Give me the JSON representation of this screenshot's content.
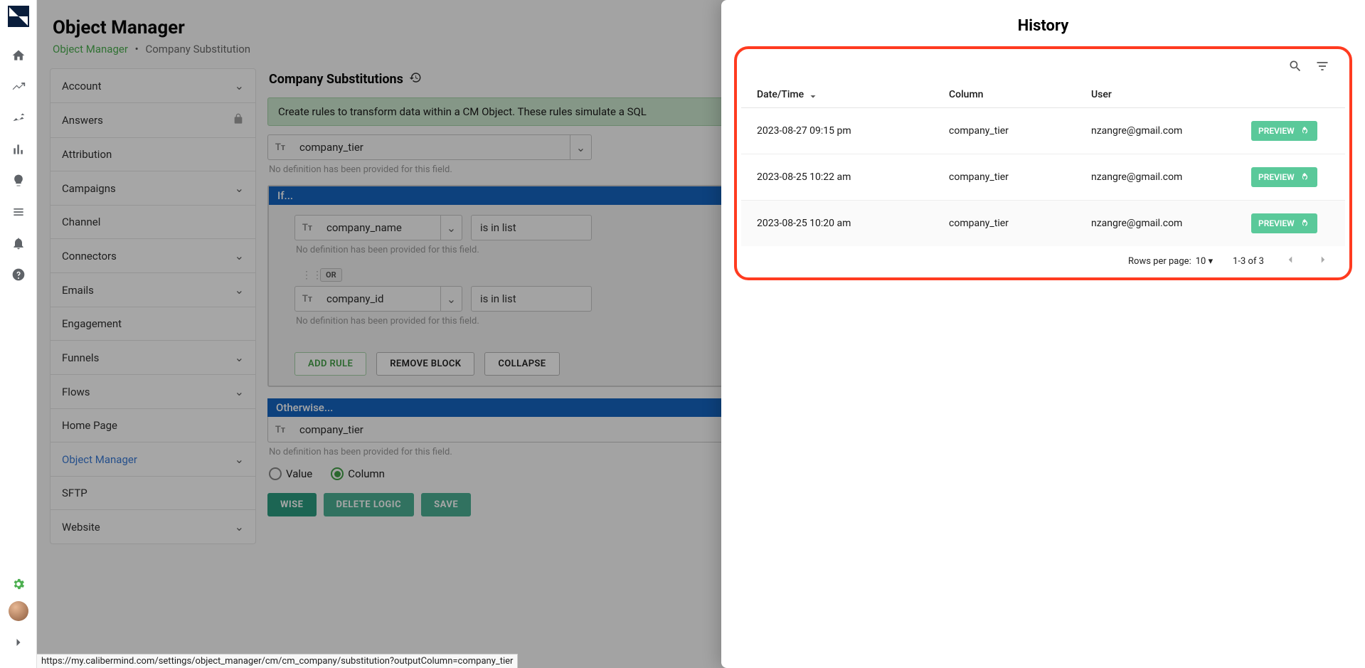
{
  "page": {
    "title": "Object Manager",
    "breadcrumb_link": "Object Manager",
    "breadcrumb_current": "Company Substitution"
  },
  "sidebar": {
    "items": [
      {
        "label": "Account",
        "chev": true
      },
      {
        "label": "Answers",
        "lock": true
      },
      {
        "label": "Attribution"
      },
      {
        "label": "Campaigns",
        "chev": true
      },
      {
        "label": "Channel"
      },
      {
        "label": "Connectors",
        "chev": true
      },
      {
        "label": "Emails",
        "chev": true
      },
      {
        "label": "Engagement"
      },
      {
        "label": "Funnels",
        "chev": true
      },
      {
        "label": "Flows",
        "chev": true
      },
      {
        "label": "Home Page"
      },
      {
        "label": "Object Manager",
        "chev": true,
        "active": true
      },
      {
        "label": "SFTP"
      },
      {
        "label": "Website",
        "chev": true
      }
    ]
  },
  "editor": {
    "title": "Company Substitutions",
    "banner": "Create rules to transform data within a CM Object. These rules simulate a SQL",
    "top_field": "company_tier",
    "no_def": "No definition has been provided for this field.",
    "if_label": "If...",
    "cond1_field": "company_name",
    "cond1_op": "is in list",
    "or_label": "OR",
    "cond2_field": "company_id",
    "cond2_op": "is in list",
    "add_rule": "ADD RULE",
    "remove_block": "REMOVE BLOCK",
    "collapse": "COLLAPSE",
    "otherwise_label": "Otherwise...",
    "otherwise_field": "company_tier",
    "radio_value": "Value",
    "radio_column": "Column",
    "footer_wise": "WISE",
    "footer_delete": "DELETE LOGIC",
    "footer_save": "SAVE"
  },
  "history": {
    "title": "History",
    "columns": {
      "dt": "Date/Time",
      "col": "Column",
      "user": "User"
    },
    "rows": [
      {
        "dt": "2023-08-27 09:15 pm",
        "col": "company_tier",
        "user": "nzangre@gmail.com"
      },
      {
        "dt": "2023-08-25 10:22 am",
        "col": "company_tier",
        "user": "nzangre@gmail.com"
      },
      {
        "dt": "2023-08-25 10:20 am",
        "col": "company_tier",
        "user": "nzangre@gmail.com"
      }
    ],
    "preview_label": "PREVIEW",
    "rows_per_page_label": "Rows per page:",
    "rows_per_page_value": "10",
    "range": "1-3 of 3"
  },
  "status_url": "https://my.calibermind.com/settings/object_manager/cm/cm_company/substitution?outputColumn=company_tier"
}
